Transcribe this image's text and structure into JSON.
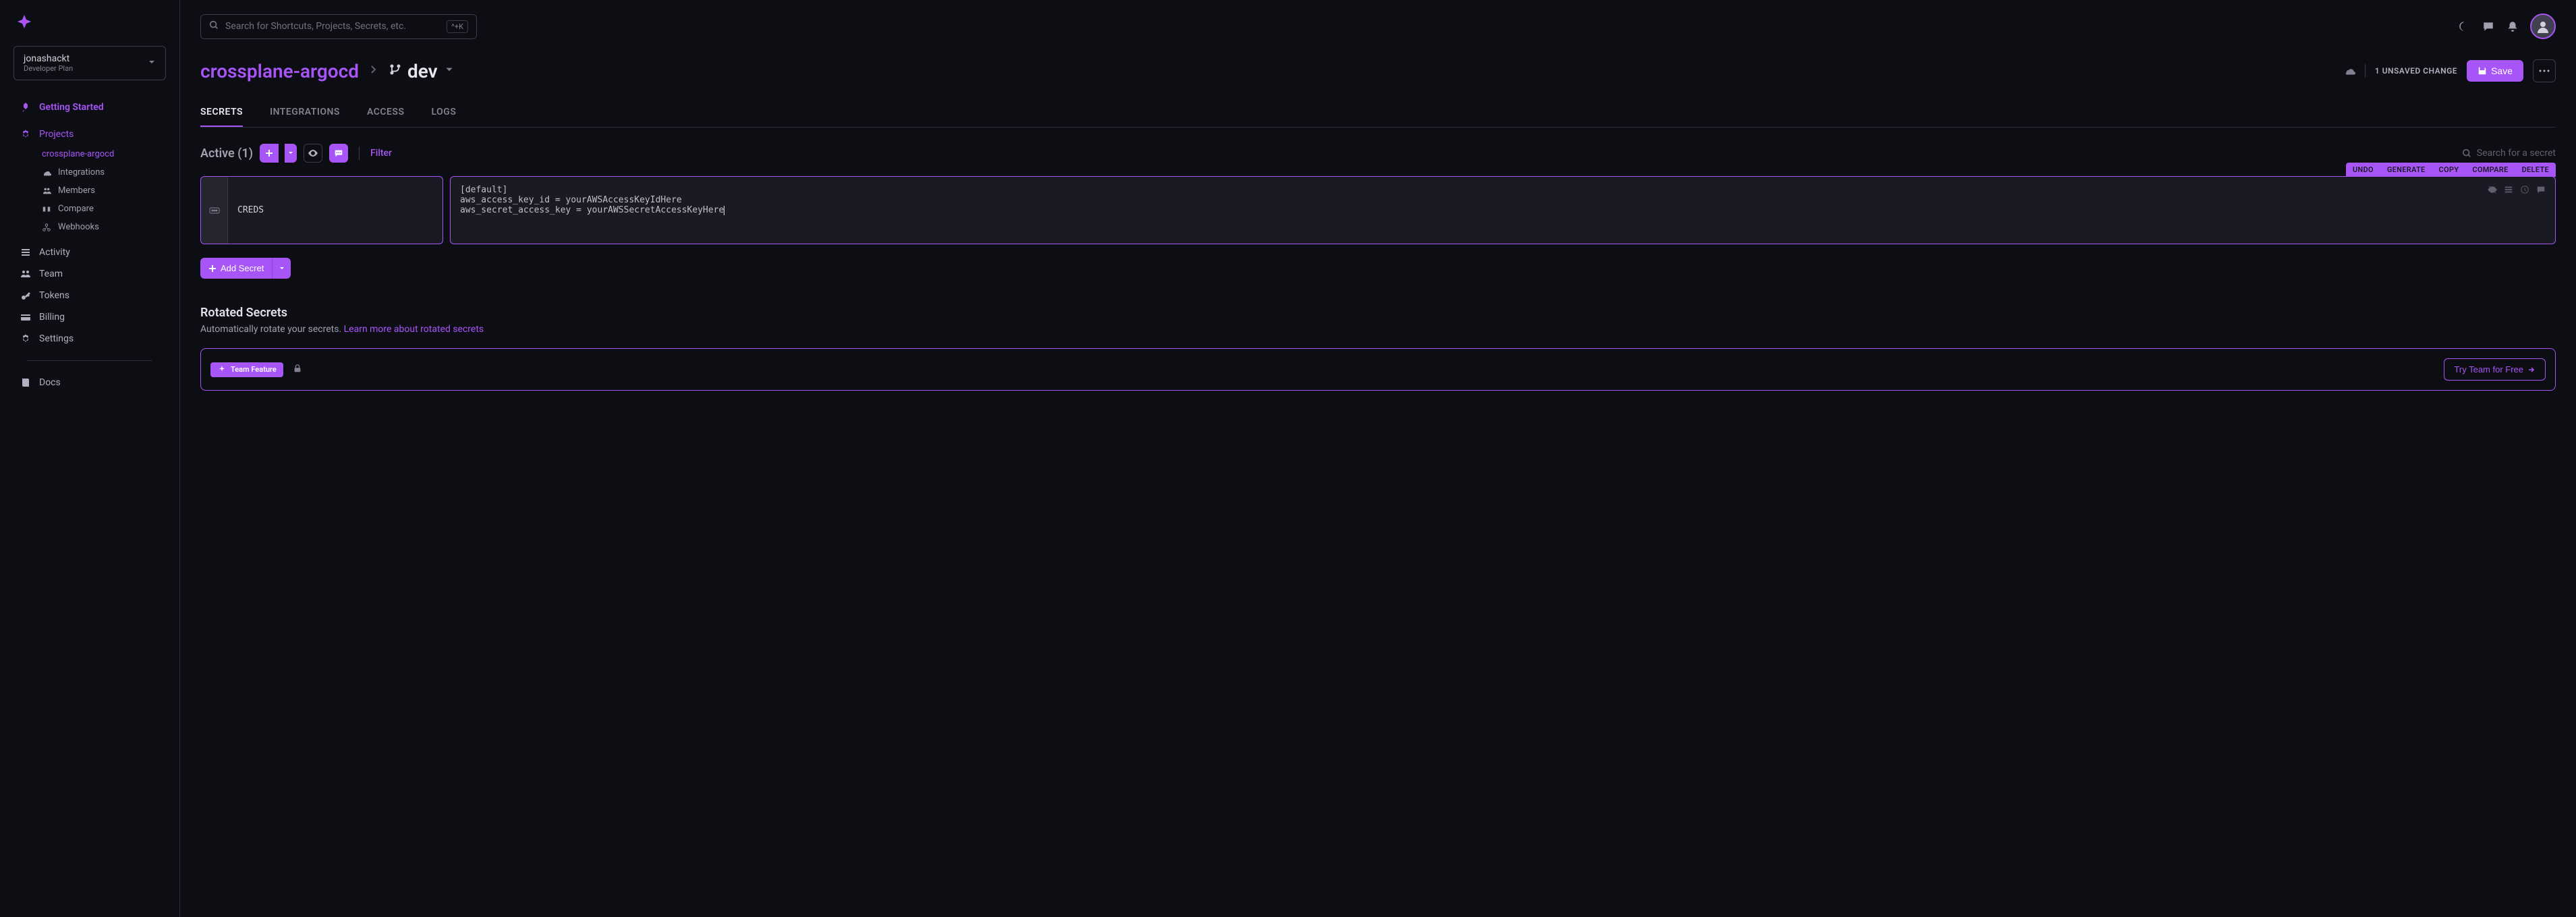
{
  "workspace": {
    "name": "jonashackt",
    "plan": "Developer Plan"
  },
  "search": {
    "placeholder": "Search for Shortcuts, Projects, Secrets, etc.",
    "shortcut": "^+K"
  },
  "sidebar": {
    "gettingStarted": "Getting Started",
    "projects": "Projects",
    "currentProject": "crossplane-argocd",
    "projectNav": {
      "integrations": "Integrations",
      "members": "Members",
      "compare": "Compare",
      "webhooks": "Webhooks"
    },
    "main": {
      "activity": "Activity",
      "team": "Team",
      "tokens": "Tokens",
      "billing": "Billing",
      "settings": "Settings"
    },
    "docs": "Docs"
  },
  "header": {
    "projectName": "crossplane-argocd",
    "branch": "dev",
    "unsaved": "1 UNSAVED CHANGE",
    "save": "Save"
  },
  "tabs": {
    "secrets": "SECRETS",
    "integrations": "INTEGRATIONS",
    "access": "ACCESS",
    "logs": "LOGS"
  },
  "secrets": {
    "activeLabel": "Active (1)",
    "filter": "Filter",
    "searchPlaceholder": "Search for a secret",
    "addSecret": "Add Secret",
    "entry": {
      "key": "CREDS",
      "value": "[default]\naws_access_key_id = yourAWSAccessKeyIdHere\naws_secret_access_key = yourAWSSecretAccessKeyHere"
    },
    "toolbar": {
      "undo": "UNDO",
      "generate": "GENERATE",
      "copy": "COPY",
      "compare": "COMPARE",
      "delete": "DELETE"
    }
  },
  "rotated": {
    "title": "Rotated Secrets",
    "desc": "Automatically rotate your secrets. ",
    "link": "Learn more about rotated secrets"
  },
  "teamBanner": {
    "badge": "Team Feature",
    "cta": "Try Team for Free"
  }
}
